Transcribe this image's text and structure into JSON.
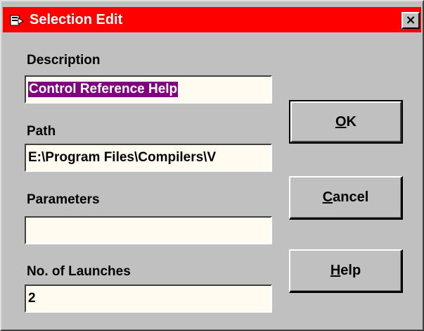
{
  "window": {
    "title": "Selection Edit",
    "close_label": "×",
    "accent_color": "#ff0000",
    "background_color": "#c0c0c0"
  },
  "form": {
    "description": {
      "label": "Description",
      "value": "Control Reference Help",
      "selected": true
    },
    "path": {
      "label": "Path",
      "value": "E:\\Program Files\\Compilers\\V"
    },
    "parameters": {
      "label": "Parameters",
      "value": ""
    },
    "launches": {
      "label": "No. of Launches",
      "value": "2"
    }
  },
  "buttons": {
    "ok": {
      "mnemonic": "O",
      "rest": "K"
    },
    "cancel": {
      "mnemonic": "C",
      "rest": "ancel"
    },
    "help": {
      "mnemonic": "H",
      "rest": "elp"
    }
  },
  "icons": {
    "app": "dialog-app-icon",
    "close": "close-icon"
  }
}
